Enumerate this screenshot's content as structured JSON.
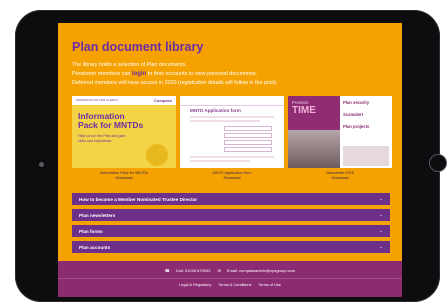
{
  "page": {
    "title": "Plan document library",
    "intro_line1": "The library holds a selection of Plan documents.",
    "intro_line2_pre": "Pensioner members can ",
    "login_link": "login",
    "intro_line2_post": " to their accounts to view personal documents.",
    "intro_line3": "Deferred members will have access in 2020 (registration details will follow in the post)."
  },
  "documents": [
    {
      "caption_line1": "Information Pack for MNTDs",
      "caption_line2": "Download",
      "cover_org": "PENSION PLAN FOR CLERGY",
      "cover_brand": "Compass",
      "cover_title_1": "Information",
      "cover_title_2": "Pack for MNTDs",
      "cover_sub": "Help us run the Plan and gain skills and experience"
    },
    {
      "caption_line1": "MNTD Application form",
      "caption_line2": "Download",
      "cover_title": "MNTD Application form"
    },
    {
      "caption_line1": "Newsletter 2019",
      "caption_line2": "Download",
      "cover_pension": "Pension",
      "cover_time": "TIME",
      "cover_side_1": "Plan security",
      "cover_side_2": "Scamalert",
      "cover_side_3": "Plan projects"
    }
  ],
  "accordion": [
    {
      "label": "How to become a Member Nominated Trustee Director"
    },
    {
      "label": "Plan newsletters"
    },
    {
      "label": "Plan forms"
    },
    {
      "label": "Plan accounts"
    }
  ],
  "footer": {
    "phone": "Call: 01245 673002",
    "email": "Email: compassadmin@cpsgroup.com",
    "links": [
      "Legal & Regulatory",
      "Terms & Conditions",
      "Terms of Use"
    ]
  },
  "icons": {
    "accordion_chevron": "chevron-down-icon",
    "phone": "phone-icon",
    "email": "envelope-icon"
  },
  "colors": {
    "background": "#f5a100",
    "accent_purple": "#6c2fa3",
    "accordion_bg": "#6d2f87",
    "footer_bg": "#8b2c72"
  }
}
